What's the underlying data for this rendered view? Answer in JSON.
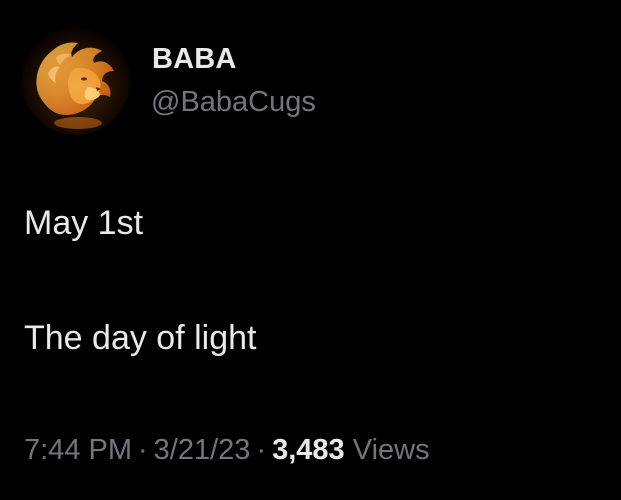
{
  "colors": {
    "background": "#000000",
    "primary_text": "#e7e9ea",
    "secondary_text": "#71767b",
    "avatar_flame": "#f5a623"
  },
  "author": {
    "avatar_icon": "lion-flame-avatar",
    "display_name": "BABA",
    "handle": "@BabaCugs"
  },
  "tweet": {
    "lines": [
      "May 1st",
      "The day of light"
    ]
  },
  "meta": {
    "time": "7:44 PM",
    "separator": "·",
    "date": "3/21/23",
    "views_count": "3,483",
    "views_label": "Views"
  }
}
